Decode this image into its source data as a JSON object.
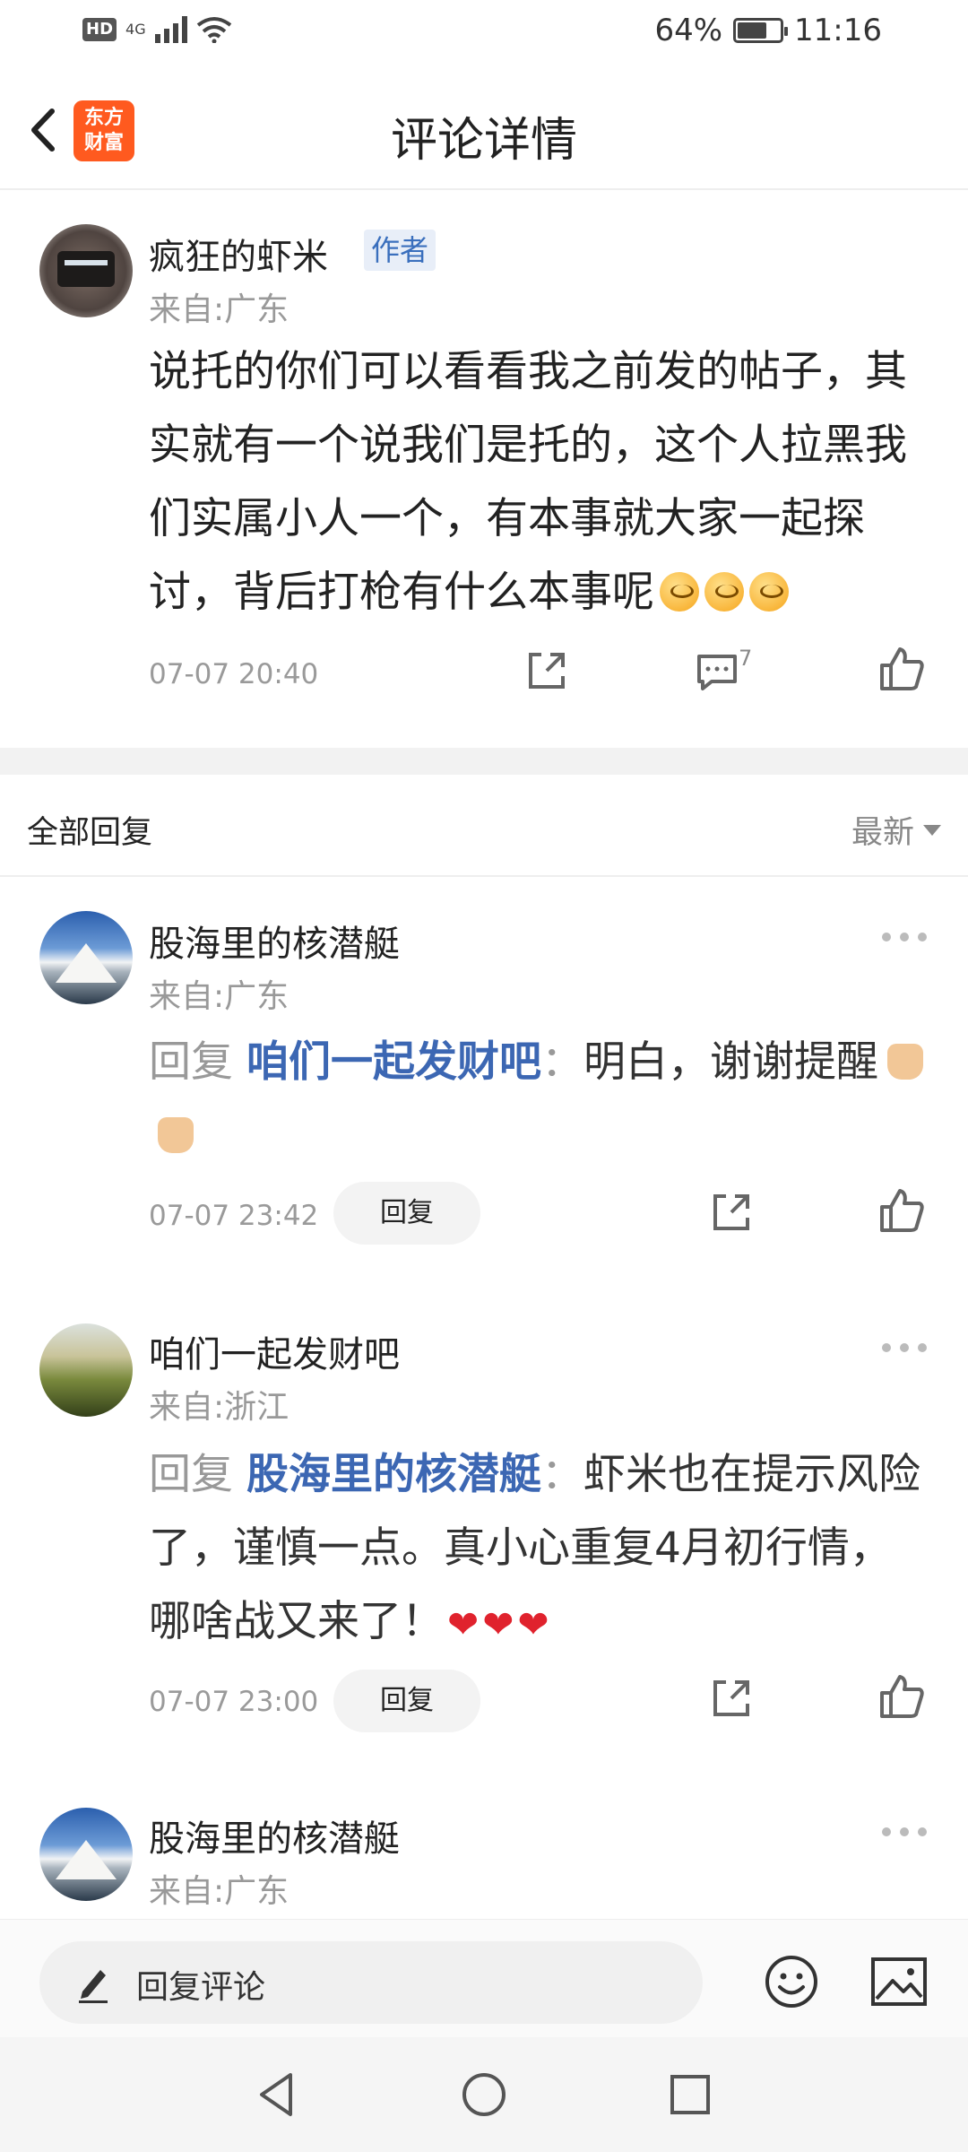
{
  "status_bar": {
    "hd": "HD",
    "network": "4G",
    "battery": "64%",
    "battery_level": 0.64,
    "time": "11:16"
  },
  "header": {
    "title": "评论详情",
    "logo_top": "东方",
    "logo_bottom": "财富"
  },
  "post": {
    "user": "疯狂的虾米",
    "badge": "作者",
    "location": "来自:广东",
    "text": "说托的你们可以看看我之前发的帖子，其实就有一个说我们是托的，这个人拉黑我们实属小人一个，有本事就大家一起探讨，背后打枪有什么本事呢",
    "time": "07-07 20:40",
    "comment_count": "7"
  },
  "replies_header": {
    "title": "全部回复",
    "sort": "最新"
  },
  "replies": [
    {
      "user": "股海里的核潜艇",
      "location": "来自:广东",
      "prefix": "回复",
      "target": "咱们一起发财吧",
      "colon": "：",
      "text": "明白，谢谢提醒",
      "time": "07-07 23:42",
      "reply_label": "回复"
    },
    {
      "user": "咱们一起发财吧",
      "location": "来自:浙江",
      "prefix": "回复",
      "target": "股海里的核潜艇",
      "colon": "：",
      "text": "虾米也在提示风险了，谨慎一点。真小心重复4月初行情，哪啥战又来了！",
      "time": "07-07 23:00",
      "reply_label": "回复"
    },
    {
      "user": "股海里的核潜艇",
      "location": "来自:广东"
    }
  ],
  "input_bar": {
    "placeholder": "回复评论"
  },
  "colors": {
    "accent_link": "#3c67b3",
    "brand": "#ff5a1f",
    "muted": "#999999"
  }
}
